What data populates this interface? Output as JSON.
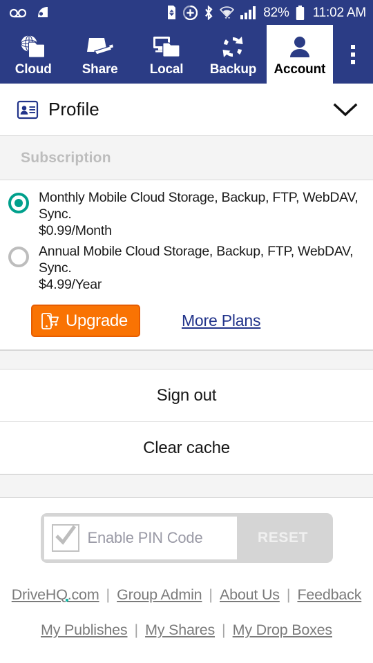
{
  "status_bar": {
    "left_icons": [
      "voicemail-icon",
      "data-saver-icon"
    ],
    "right_icons": [
      "sd-card-icon",
      "do-not-disturb-icon",
      "bluetooth-icon",
      "wifi-icon",
      "cellular-signal-icon"
    ],
    "battery_percent": "82%",
    "battery_icon": "battery-icon",
    "clock": "11:02 AM"
  },
  "tabs": [
    {
      "label": "Cloud",
      "icon": "cloud-folder-icon",
      "active": false
    },
    {
      "label": "Share",
      "icon": "share-folder-icon",
      "active": false
    },
    {
      "label": "Local",
      "icon": "local-monitor-icon",
      "active": false
    },
    {
      "label": "Backup",
      "icon": "backup-sync-icon",
      "active": false
    },
    {
      "label": "Account",
      "icon": "account-person-icon",
      "active": true
    }
  ],
  "overflow_menu": "more-options-icon",
  "profile": {
    "icon": "contact-card-icon",
    "title": "Profile",
    "expander": "chevron-down-icon"
  },
  "subscription": {
    "header": "Subscription",
    "plans": [
      {
        "line1": "Monthly Mobile Cloud Storage, Backup, FTP, WebDAV, Sync.",
        "line2": "$0.99/Month",
        "selected": true
      },
      {
        "line1": "Annual Mobile Cloud Storage, Backup, FTP, WebDAV, Sync.",
        "line2": "$4.99/Year",
        "selected": false
      }
    ],
    "upgrade_label": "Upgrade",
    "upgrade_icon": "mobile-cart-icon",
    "more_plans_label": "More Plans"
  },
  "actions": [
    {
      "label": "Sign out"
    },
    {
      "label": "Clear cache"
    }
  ],
  "pin": {
    "label": "Enable PIN Code",
    "checked": true,
    "reset_label": "RESET"
  },
  "footer": {
    "row1": [
      "DriveHQ.com",
      "Group Admin",
      "About Us",
      "Feedback"
    ],
    "row2": [
      "My Publishes",
      "My Shares",
      "My Drop Boxes"
    ],
    "separator": "|"
  },
  "colors": {
    "header_blue": "#2b3c85",
    "accent_teal": "#00a08c",
    "upgrade_orange": "#f97303",
    "link_navy": "#21338a",
    "band_gray": "#f4f4f4"
  }
}
